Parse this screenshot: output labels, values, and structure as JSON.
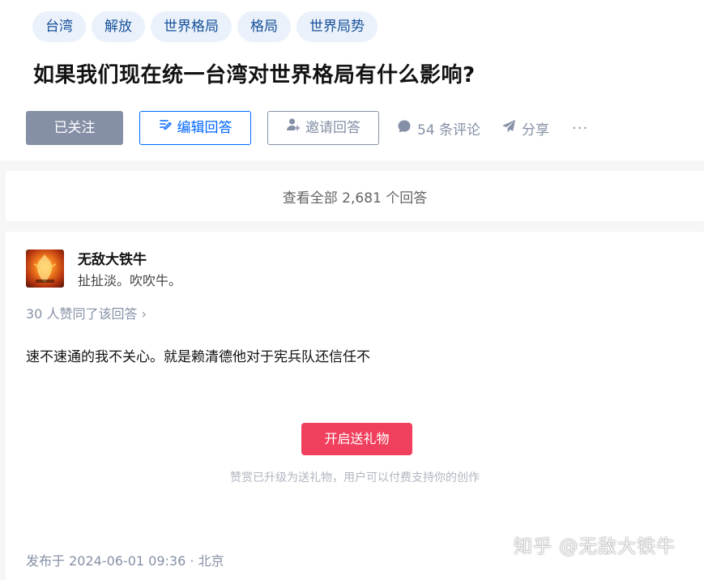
{
  "topics": [
    "台湾",
    "解放",
    "世界格局",
    "格局",
    "世界局势"
  ],
  "question": {
    "title": "如果我们现在统一台湾对世界格局有什么影响?"
  },
  "actions": {
    "follow_label": "已关注",
    "edit_answer_label": "编辑回答",
    "invite_label": "邀请回答",
    "comments_label": "54 条评论",
    "share_label": "分享",
    "more_label": "···"
  },
  "view_all": {
    "label": "查看全部 2,681 个回答"
  },
  "answer": {
    "author_name": "无敌大铁牛",
    "author_bio": "扯扯淡。吹吹牛。",
    "votes_label": "30 人赞同了该回答 ›",
    "content": "速不速通的我不关心。就是赖清德他对于宪兵队还信任不",
    "gift_button": "开启送礼物",
    "gift_note": "赞赏已升级为送礼物，用户可以付费支持你的创作",
    "published": "发布于 2024-06-01 09:36 · 北京"
  },
  "watermark": "知乎 @无敌大铁牛",
  "colors": {
    "follow_bg": "#8590a6",
    "primary_blue": "#0066ff",
    "topic_bg": "#eaf1fb",
    "topic_text": "#175199",
    "gift_red": "#f1405d",
    "meta_gray": "#8590a6"
  },
  "icons": {
    "edit": "edit-icon",
    "invite": "invite-user-icon",
    "comment": "comment-bubble-icon",
    "share": "paper-plane-icon",
    "more": "more-dots-icon"
  }
}
